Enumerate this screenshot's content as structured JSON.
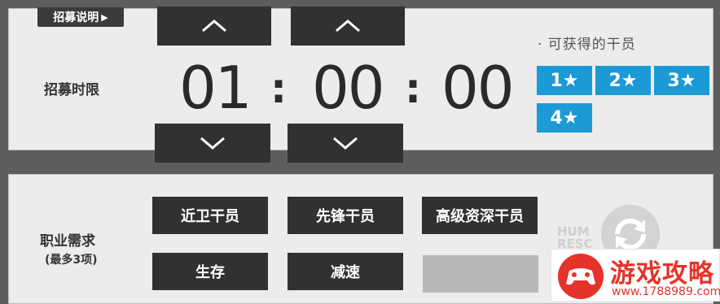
{
  "recruit": {
    "info_button": "招募说明",
    "info_arrow": "▶",
    "time_label": "招募时限",
    "hours": "01",
    "minutes": "00",
    "seconds": "00",
    "separator": ":",
    "available_title": "· 可获得的干员",
    "stars": [
      "1★",
      "2★",
      "3★",
      "4★"
    ]
  },
  "tags": {
    "label": "职业需求",
    "sublabel": "(最多3项)",
    "items": [
      "近卫干员",
      "先锋干员",
      "高级资深干员",
      "生存",
      "减速"
    ]
  },
  "background": {
    "faint_text_1": "HUM",
    "faint_text_2": "RESC"
  },
  "watermark": {
    "title": "游戏攻略",
    "url": "www.1788989.com"
  },
  "colors": {
    "accent_blue": "#1b9ad6",
    "button_dark": "#313131",
    "panel_bg": "#ececec",
    "watermark_red": "#e5332a"
  },
  "icons": [
    "chevron-up-icon",
    "chevron-down-icon",
    "refresh-icon",
    "gamepad-logo-icon"
  ]
}
